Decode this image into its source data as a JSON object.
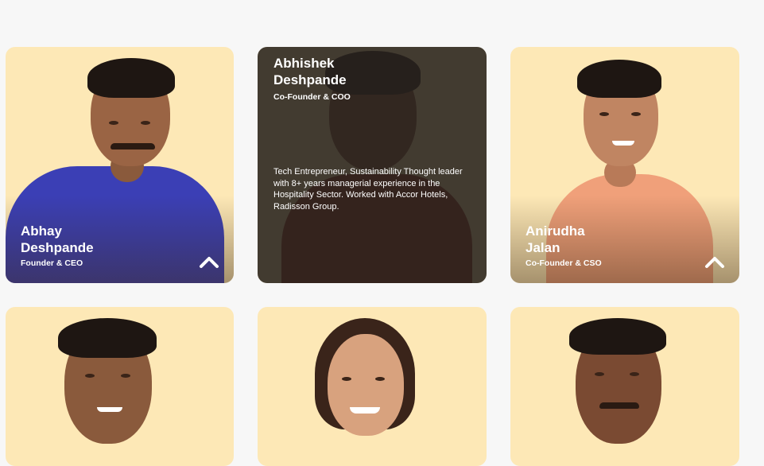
{
  "team": [
    {
      "name_line1": "Abhay",
      "name_line2": "Deshpande",
      "role": "Founder & CEO",
      "expanded": false,
      "shirt_color": "#3b3fb5"
    },
    {
      "name_line1": "Abhishek",
      "name_line2": "Deshpande",
      "role": "Co-Founder & COO",
      "expanded": true,
      "bio": "Tech Entrepreneur, Sustainability Thought leader with 8+ years managerial experience in the Hospitality Sector. Worked with Accor Hotels, Radisson Group.",
      "shirt_color": "#8a2a1f"
    },
    {
      "name_line1": "Anirudha",
      "name_line2": "Jalan",
      "role": "Co-Founder & CSO",
      "expanded": false,
      "shirt_color": "#f0a07a"
    },
    {
      "expanded": false,
      "shirt_color": "#e8c9a0"
    },
    {
      "expanded": false,
      "shirt_color": "#e8c9a0"
    },
    {
      "expanded": false,
      "shirt_color": "#e8c9a0"
    }
  ],
  "colors": {
    "card_bg": "#fde8b6",
    "page_bg": "#f7f7f7",
    "overlay": "#28221e"
  },
  "icons": {
    "expand": "chevron-up-icon"
  }
}
